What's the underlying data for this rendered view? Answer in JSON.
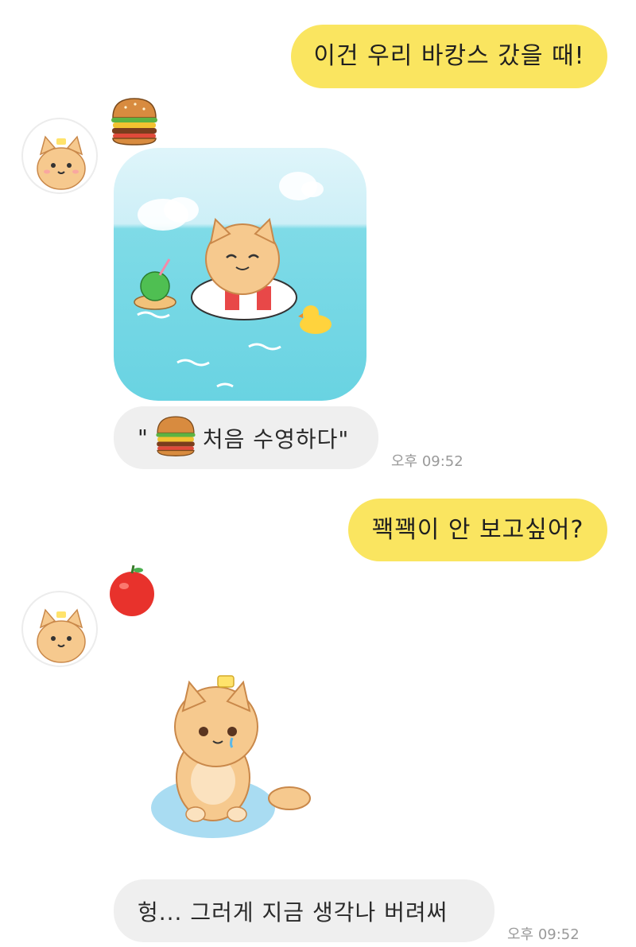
{
  "messages": {
    "m1": {
      "text": "이건 우리 바캉스 갔을 때!"
    },
    "m2": {
      "emoji": "burger-emoji"
    },
    "m3": {
      "image": "cat-swimming-photo"
    },
    "m4": {
      "quote_open": "\"",
      "text": "처음 수영하다\"",
      "time": "오후 09:52"
    },
    "m5": {
      "text": "꽥꽥이 안 보고싶어?"
    },
    "m6": {
      "emoji": "apple-emoji"
    },
    "m7": {
      "sticker": "crying-cat-sticker"
    },
    "m8": {
      "text": "헝... 그러게 지금 생각나 버려써",
      "time": "오후 09:52"
    }
  },
  "colors": {
    "outgoing_bubble": "#fae560",
    "incoming_bubble": "#efefef",
    "timestamp": "#9a9a9a",
    "cat_fur": "#f6c98e"
  }
}
